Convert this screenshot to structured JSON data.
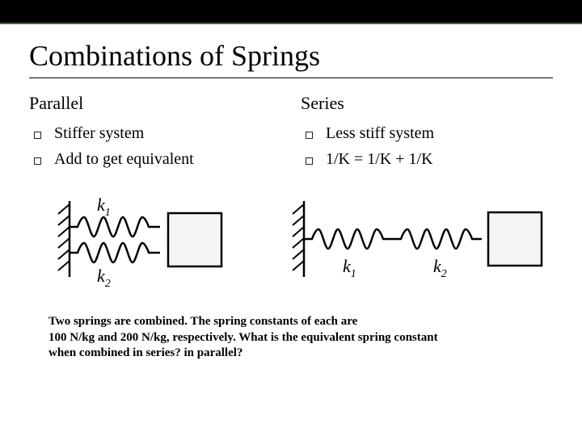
{
  "title": "Combinations of Springs",
  "left": {
    "heading": "Parallel",
    "bullets": [
      "Stiffer system",
      "Add to get equivalent"
    ],
    "labels": {
      "k1": "k",
      "k1sub": "1",
      "k2": "k",
      "k2sub": "2"
    }
  },
  "right": {
    "heading": "Series",
    "bullets": [
      "Less stiff system",
      "1/K = 1/K + 1/K"
    ],
    "labels": {
      "k1": "k",
      "k1sub": "1",
      "k2": "k",
      "k2sub": "2"
    }
  },
  "problem": {
    "line1": "Two springs are combined.  The spring constants of each are",
    "line2": "100 N/kg and 200 N/kg, respectively.  What is the equivalent spring constant",
    "line3": "when combined in series? in parallel?"
  }
}
